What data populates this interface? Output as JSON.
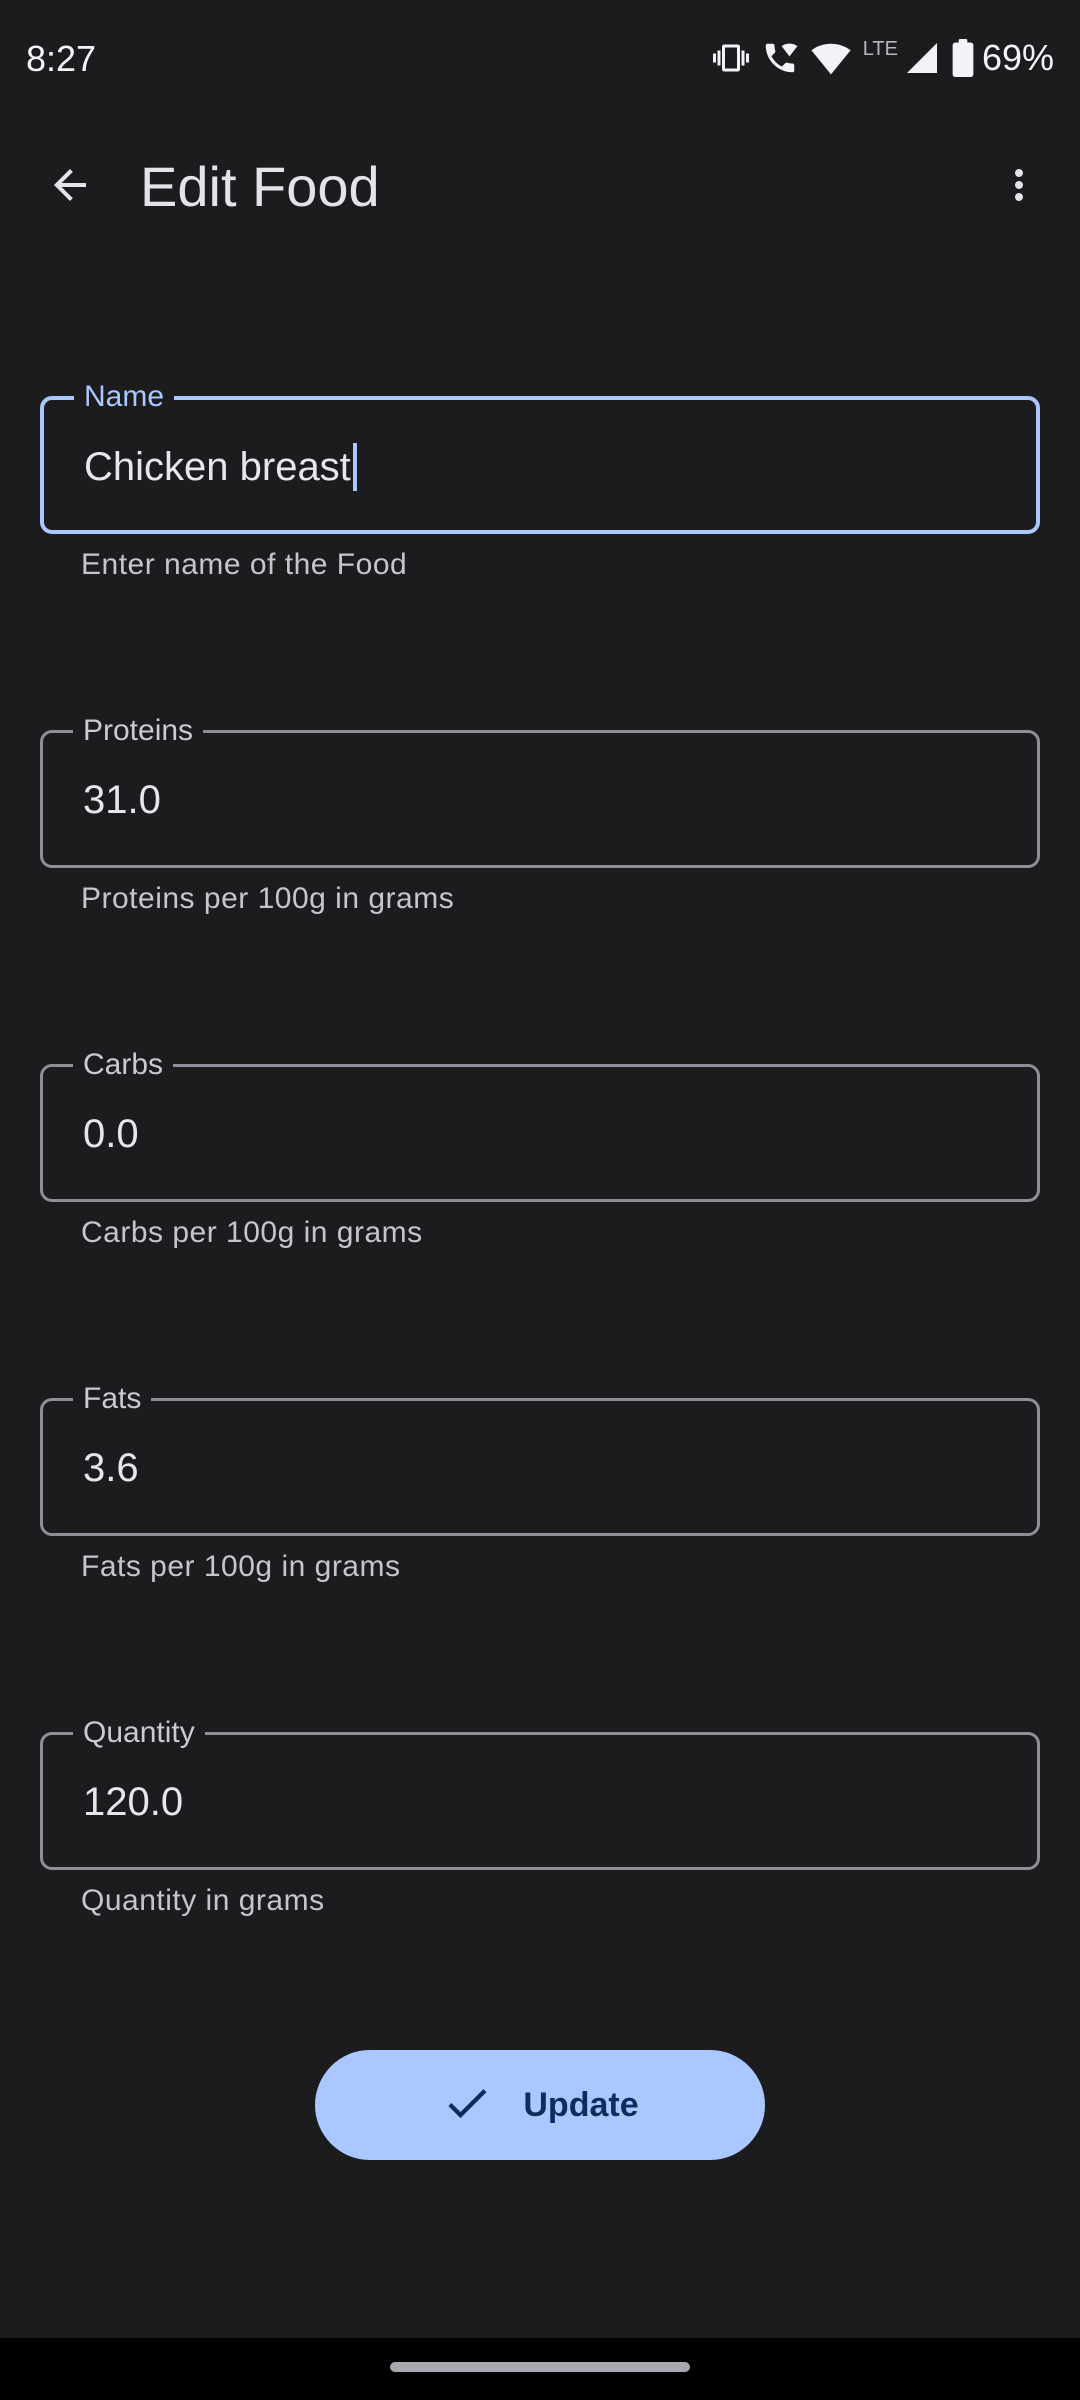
{
  "status_bar": {
    "time": "8:27",
    "network_label": "LTE",
    "battery_percent": "69%",
    "icons": [
      "vibrate-icon",
      "wifi-calling-icon",
      "wifi-icon",
      "cell-signal-icon",
      "battery-icon"
    ]
  },
  "app_bar": {
    "title": "Edit Food",
    "back_icon": "arrow-back-icon",
    "menu_icon": "more-vert-icon"
  },
  "form": {
    "name": {
      "label": "Name",
      "value": "Chicken breast",
      "helper": "Enter name of the Food",
      "focused": true
    },
    "proteins": {
      "label": "Proteins",
      "value": "31.0",
      "helper": "Proteins per 100g in grams"
    },
    "carbs": {
      "label": "Carbs",
      "value": "0.0",
      "helper": "Carbs per 100g in grams"
    },
    "fats": {
      "label": "Fats",
      "value": "3.6",
      "helper": "Fats per 100g in grams"
    },
    "quantity": {
      "label": "Quantity",
      "value": "120.0",
      "helper": "Quantity in grams"
    }
  },
  "actions": {
    "update_label": "Update",
    "update_icon": "check-icon"
  },
  "colors": {
    "background": "#1c1c1f",
    "accent": "#aac7ff",
    "outline": "#8f8e96",
    "button_text": "#0d2e5c"
  }
}
